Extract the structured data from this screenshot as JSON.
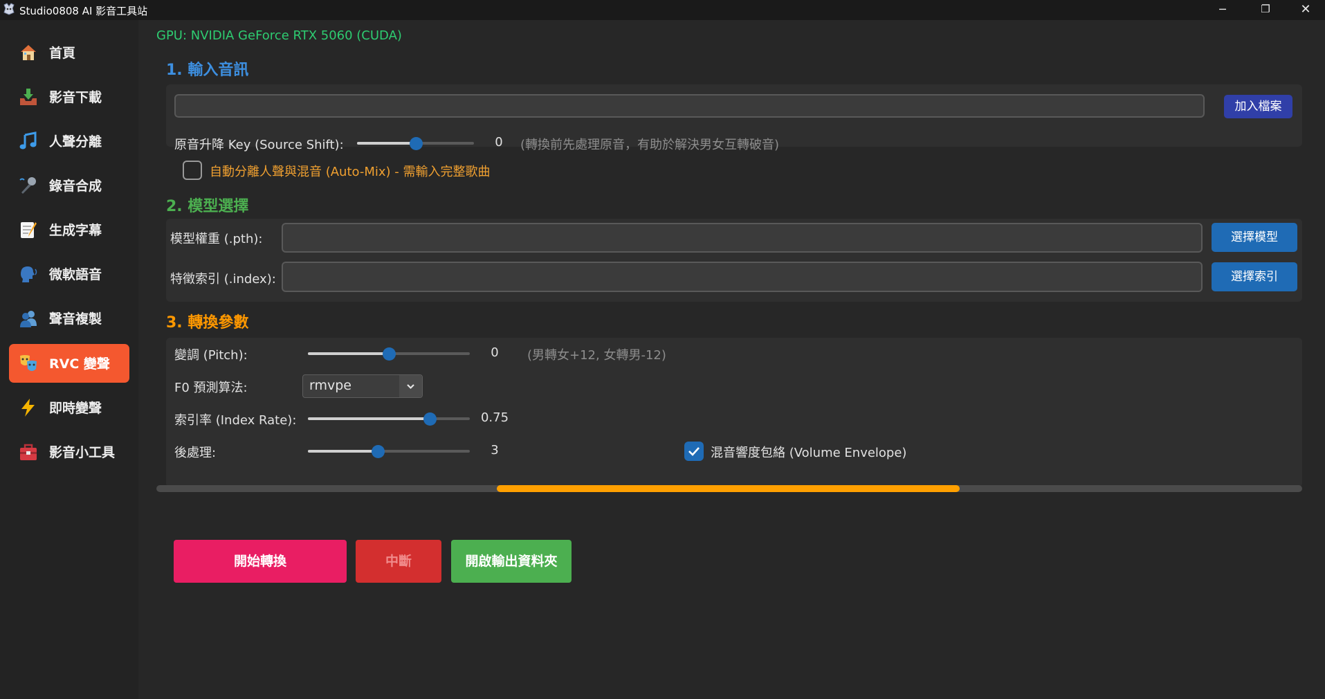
{
  "window": {
    "title": "Studio0808 AI 影音工具站",
    "controls": {
      "minimize": "─",
      "restore": "❐",
      "close": "✕"
    }
  },
  "sidebar": {
    "items": [
      {
        "label": "首頁",
        "icon": "house-icon",
        "active": false
      },
      {
        "label": "影音下載",
        "icon": "download-tray-icon",
        "active": false
      },
      {
        "label": "人聲分離",
        "icon": "music-note-icon",
        "active": false
      },
      {
        "label": "錄音合成",
        "icon": "microphone-icon",
        "active": false
      },
      {
        "label": "生成字幕",
        "icon": "memo-icon",
        "active": false
      },
      {
        "label": "微軟語音",
        "icon": "speaking-head-icon",
        "active": false
      },
      {
        "label": "聲音複製",
        "icon": "busts-icon",
        "active": false
      },
      {
        "label": "RVC 變聲",
        "icon": "theater-masks-icon",
        "active": true
      },
      {
        "label": "即時變聲",
        "icon": "lightning-icon",
        "active": false
      },
      {
        "label": "影音小工具",
        "icon": "toolbox-icon",
        "active": false
      }
    ],
    "active_color": "#f4582f"
  },
  "main": {
    "gpu_status": "GPU: NVIDIA GeForce RTX 5060 (CUDA)",
    "section1": {
      "title": "1. 輸入音訊",
      "file_path": "",
      "add_file_button": "加入檔案",
      "source_shift": {
        "label": "原音升降 Key (Source Shift):",
        "value": "0",
        "fraction": 0.5,
        "hint": "(轉換前先處理原音，有助於解決男女互轉破音)"
      },
      "auto_mix": {
        "label": "自動分離人聲與混音 (Auto-Mix) - 需輸入完整歌曲",
        "checked": false
      }
    },
    "section2": {
      "title": "2. 模型選擇",
      "model_label": "模型權重 (.pth):",
      "model_path": "",
      "model_button": "選擇模型",
      "index_label": "特徵索引 (.index):",
      "index_path": "",
      "index_button": "選擇索引"
    },
    "section3": {
      "title": "3. 轉換參數",
      "pitch": {
        "label": "變調 (Pitch):",
        "value": "0",
        "fraction": 0.5,
        "hint": "(男轉女+12, 女轉男-12)"
      },
      "f0": {
        "label": "F0 預測算法:",
        "selected": "rmvpe"
      },
      "index_rate": {
        "label": "索引率 (Index Rate):",
        "value": "0.75",
        "fraction": 0.75
      },
      "post_process": {
        "label": "後處理:",
        "value": "3",
        "fraction": 0.43
      },
      "volume_envelope": {
        "label": "混音響度包絡 (Volume Envelope)",
        "checked": true
      }
    },
    "progress": {
      "start": 0.297,
      "end": 0.701
    },
    "buttons": {
      "start": "開始轉換",
      "stop": "中斷",
      "open_output": "開啟輸出資料夾"
    },
    "colors": {
      "section1": "#3d8fe0",
      "section2": "#4caf50",
      "section3": "#ff9800",
      "accent_blue": "#1f6bb5",
      "start": "#e91e63",
      "stop": "#d32f2f",
      "open_output": "#4caf50",
      "progress": "#ffa000",
      "auto_mix_text": "#f0a030"
    }
  }
}
